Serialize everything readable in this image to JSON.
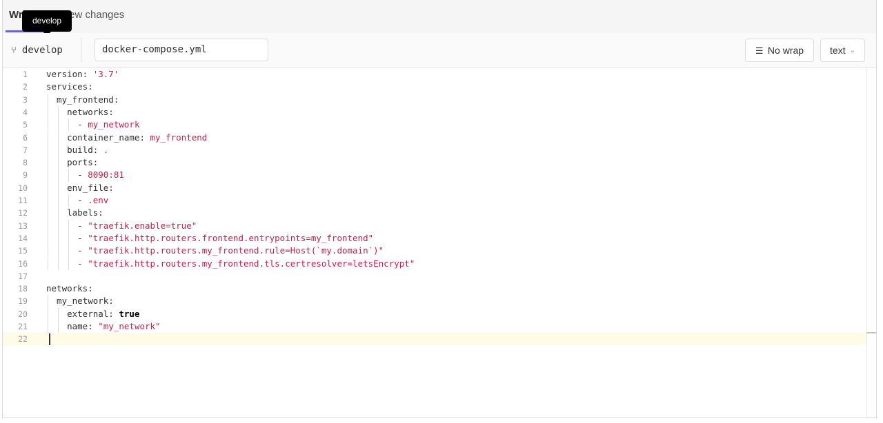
{
  "tabs": {
    "write": "Write",
    "preview": "Preview changes"
  },
  "tooltip": "develop",
  "toolbar": {
    "branch": "develop",
    "filename": "docker-compose.yml",
    "no_wrap": "No wrap",
    "language": "text"
  },
  "code_lines": [
    {
      "n": "1",
      "parts": [
        {
          "t": "version: "
        },
        {
          "t": "'3.7'",
          "c": "str"
        }
      ]
    },
    {
      "n": "2",
      "parts": [
        {
          "t": "services:"
        }
      ]
    },
    {
      "n": "3",
      "parts": [
        {
          "t": "  my_frontend:"
        }
      ]
    },
    {
      "n": "4",
      "parts": [
        {
          "t": "    networks:"
        }
      ]
    },
    {
      "n": "5",
      "parts": [
        {
          "t": "      - "
        },
        {
          "t": "my_network",
          "c": "str"
        }
      ]
    },
    {
      "n": "6",
      "parts": [
        {
          "t": "    container_name: "
        },
        {
          "t": "my_frontend",
          "c": "str"
        }
      ]
    },
    {
      "n": "7",
      "parts": [
        {
          "t": "    build: "
        },
        {
          "t": ".",
          "c": "str"
        }
      ]
    },
    {
      "n": "8",
      "parts": [
        {
          "t": "    ports:"
        }
      ]
    },
    {
      "n": "9",
      "parts": [
        {
          "t": "      - "
        },
        {
          "t": "8090:81",
          "c": "str"
        }
      ]
    },
    {
      "n": "10",
      "parts": [
        {
          "t": "    env_file:"
        }
      ]
    },
    {
      "n": "11",
      "parts": [
        {
          "t": "      - "
        },
        {
          "t": ".env",
          "c": "str"
        }
      ]
    },
    {
      "n": "12",
      "parts": [
        {
          "t": "    labels:"
        }
      ]
    },
    {
      "n": "13",
      "parts": [
        {
          "t": "      - "
        },
        {
          "t": "\"traefik.enable=true\"",
          "c": "str"
        }
      ]
    },
    {
      "n": "14",
      "parts": [
        {
          "t": "      - "
        },
        {
          "t": "\"traefik.http.routers.frontend.entrypoints=my_frontend\"",
          "c": "str"
        }
      ]
    },
    {
      "n": "15",
      "parts": [
        {
          "t": "      - "
        },
        {
          "t": "\"traefik.http.routers.my_frontend.rule=Host(`my.domain`)\"",
          "c": "str"
        }
      ]
    },
    {
      "n": "16",
      "parts": [
        {
          "t": "      - "
        },
        {
          "t": "\"traefik.http.routers.my_frontend.tls.certresolver=letsEncrypt\"",
          "c": "str"
        }
      ]
    },
    {
      "n": "17",
      "parts": []
    },
    {
      "n": "18",
      "parts": [
        {
          "t": "networks:"
        }
      ]
    },
    {
      "n": "19",
      "parts": [
        {
          "t": "  my_network:"
        }
      ]
    },
    {
      "n": "20",
      "parts": [
        {
          "t": "    external: "
        },
        {
          "t": "true",
          "c": "kw"
        }
      ]
    },
    {
      "n": "21",
      "parts": [
        {
          "t": "    name: "
        },
        {
          "t": "\"my_network\"",
          "c": "str"
        }
      ]
    },
    {
      "n": "22",
      "parts": []
    }
  ],
  "active_line": "22"
}
